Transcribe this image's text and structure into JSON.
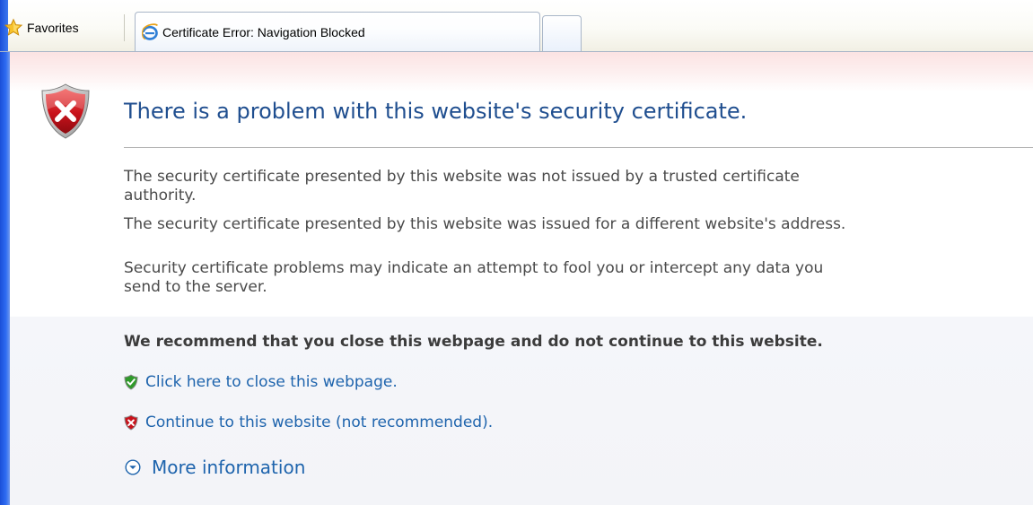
{
  "tabbar": {
    "favorites_label": "Favorites",
    "active_tab_title": "Certificate Error: Navigation Blocked"
  },
  "page": {
    "headline": "There is a problem with this website's security certificate.",
    "paragraphs": [
      "The security certificate presented by this website was not issued by a trusted certificate",
      "authority.",
      "The security certificate presented by this website was issued for a different website's address.",
      "Security certificate problems may indicate an attempt to fool you or intercept any data you",
      "send to the server."
    ],
    "recommendation": "We recommend that you close this webpage and do not continue to this website.",
    "close_link": "Click here to close this webpage.",
    "continue_link": "Continue to this website (not recommended).",
    "more_info_label": "More information"
  },
  "colors": {
    "headline": "#1f4e8f",
    "link": "#1e64ad",
    "body_text": "#4a4a4a",
    "shield_red": "#c8121b",
    "shield_green": "#2f9a2a",
    "window_blue": "#2e6cf2"
  },
  "icons": {
    "favorites": "star-icon",
    "tab": "internet-explorer-icon",
    "header": "error-shield-icon",
    "close_link": "green-check-shield-icon",
    "continue_link": "red-x-shield-icon",
    "more_info": "chevron-down-circle-icon"
  }
}
